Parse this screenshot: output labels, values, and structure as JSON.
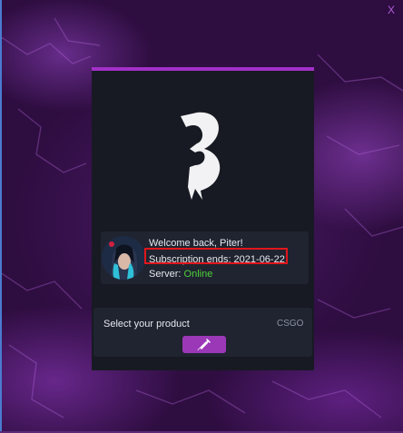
{
  "window": {
    "close_label": "X"
  },
  "user": {
    "welcome": "Welcome back, Piter!",
    "subscription": "Subscription ends: 2021-06-22",
    "server_label": "Server:",
    "server_status": "Online"
  },
  "product": {
    "select_label": "Select your product",
    "name": "CSGO",
    "inject_icon": "syringe-icon"
  },
  "colors": {
    "accent": "#a330c8",
    "panel": "#171a22",
    "card": "#1f2430",
    "online": "#4fd03a",
    "highlight": "#e0161b"
  }
}
